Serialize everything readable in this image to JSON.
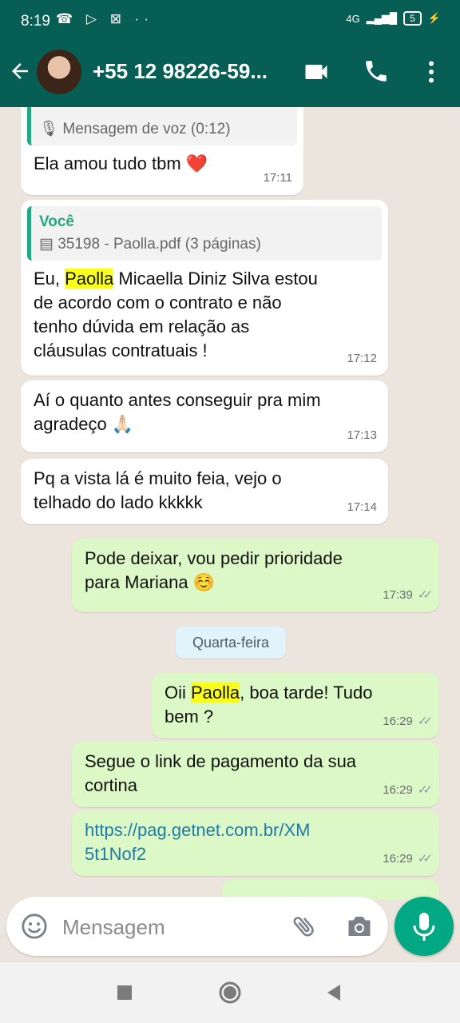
{
  "status": {
    "time": "8:19",
    "network": "4G",
    "battery": "5"
  },
  "header": {
    "contact": "+55 12 98226-59..."
  },
  "messages": [
    {
      "quote_sub": "Mensagem de voz (0:12)",
      "text": "Ela amou tudo tbm ❤️",
      "time": "17:11"
    },
    {
      "quote_name": "Você",
      "quote_sub": "35198 - Paolla.pdf (3 páginas)",
      "text_pre": "Eu, ",
      "highlight": "Paolla",
      "text_post": " Micaella Diniz Silva estou de acordo com o contrato e não tenho dúvida em relação as cláusulas contratuais !",
      "time": "17:12"
    },
    {
      "text": "Aí o quanto antes conseguir pra mim agradeço 🙏🏻",
      "time": "17:13"
    },
    {
      "text": "Pq a vista lá é muito feia, vejo o telhado do lado kkkkk",
      "time": "17:14"
    },
    {
      "text": "Pode deixar, vou pedir prioridade para Mariana ☺️",
      "time": "17:39"
    },
    {
      "text_pre": "Oii ",
      "highlight": "Paolla",
      "text_post": ", boa tarde! Tudo bem ?",
      "time": "16:29"
    },
    {
      "text": "Segue o link de pagamento da sua cortina",
      "time": "16:29"
    },
    {
      "text": "https://pag.getnet.com.br/XM5t1Nof2",
      "time": "16:29"
    }
  ],
  "day_divider": "Quarta-feira",
  "composer": {
    "placeholder": "Mensagem"
  },
  "colors": {
    "header": "#075e54",
    "outgoing": "#dcf8c6",
    "accent": "#00a884"
  },
  "icons": [
    "back-arrow-icon",
    "video-call-icon",
    "phone-icon",
    "more-vert-icon",
    "mic-small-icon",
    "document-icon",
    "emoji-icon",
    "attach-icon",
    "camera-icon",
    "mic-icon",
    "nav-recents-icon",
    "nav-home-icon",
    "nav-back-icon"
  ]
}
